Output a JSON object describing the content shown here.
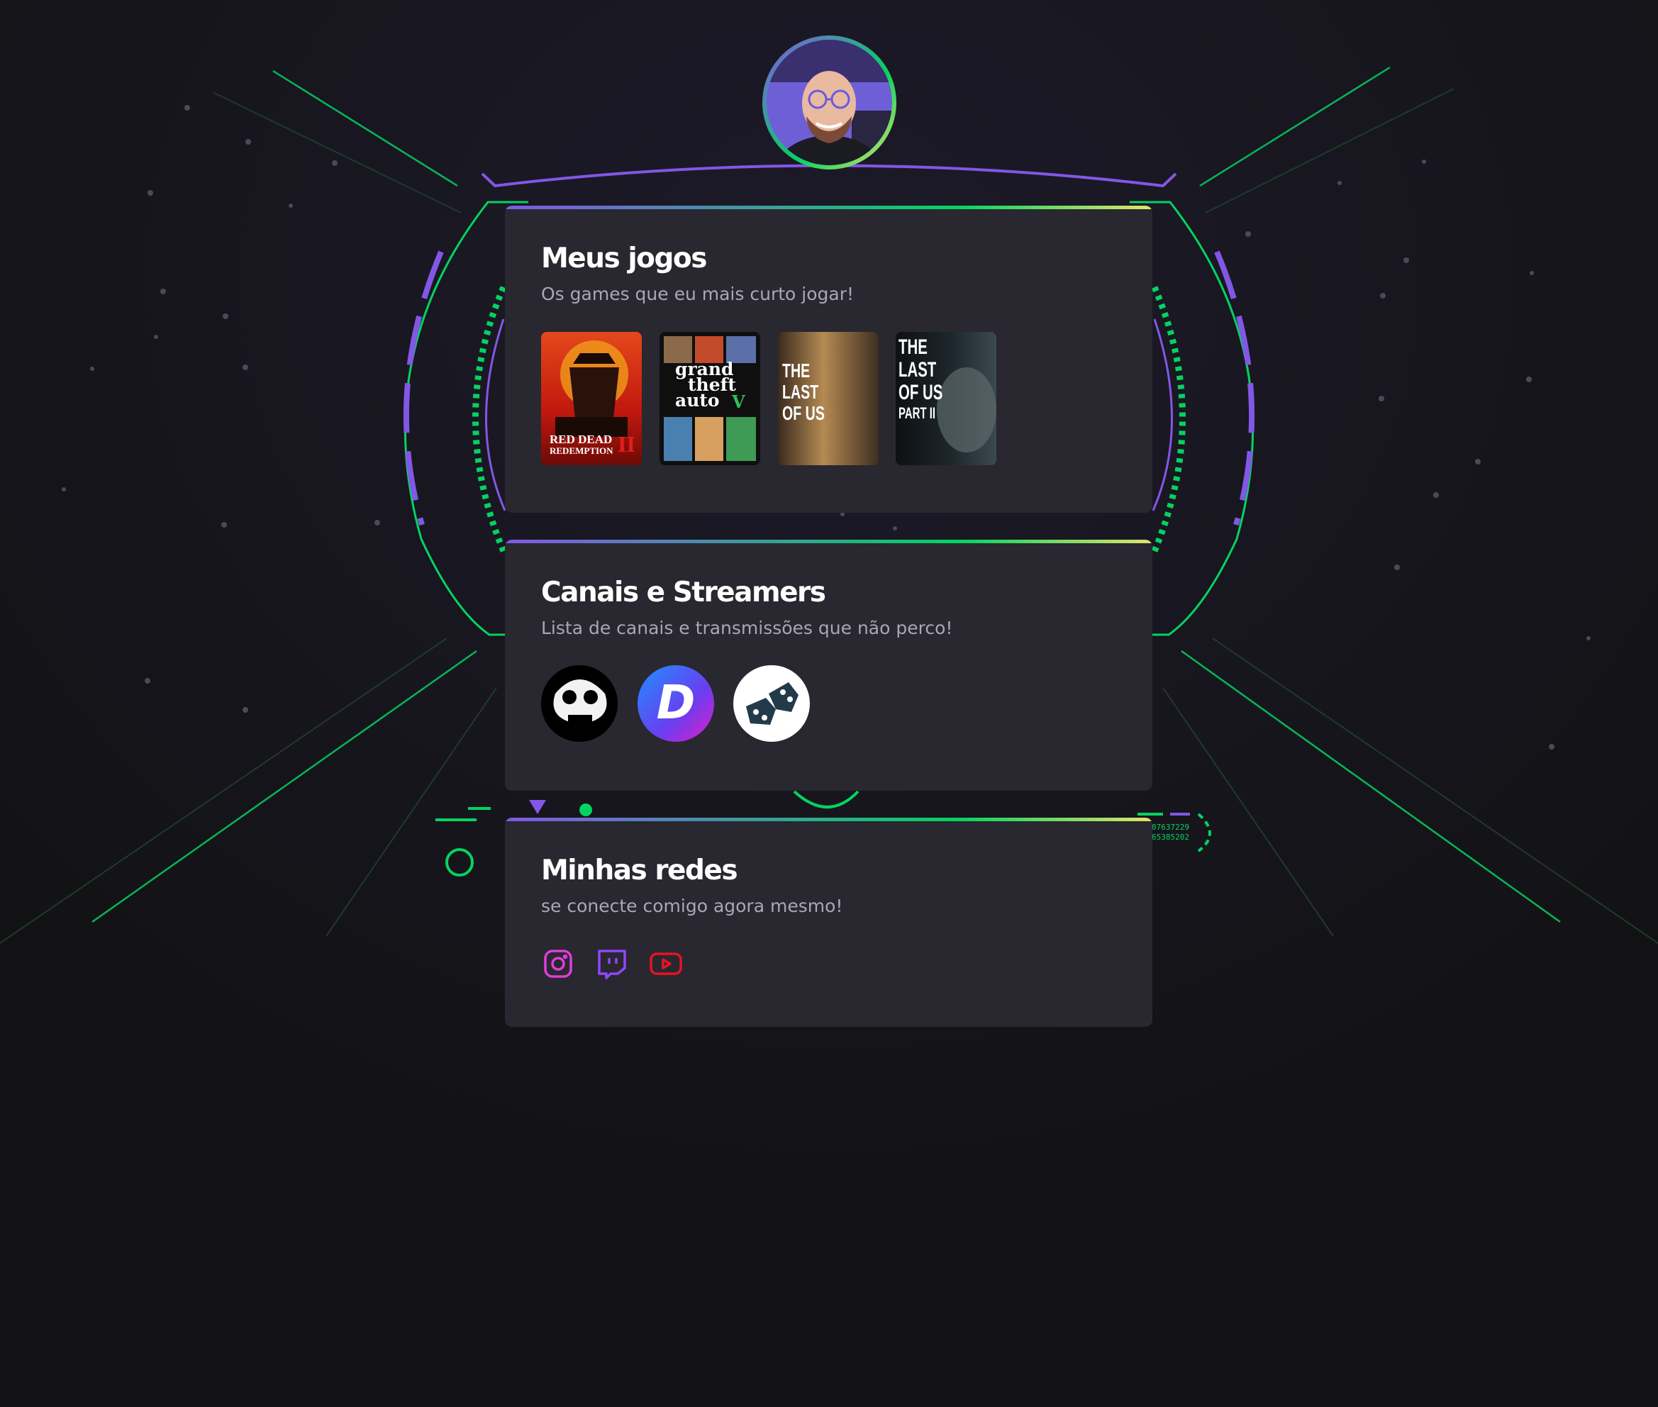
{
  "profile": {
    "avatar_alt": "avatar"
  },
  "sections": {
    "games": {
      "title": "Meus jogos",
      "subtitle": "Os games que eu mais curto jogar!",
      "items": [
        {
          "name": "Red Dead Redemption II",
          "lines": [
            "RED DEAD",
            "REDEMPTION"
          ],
          "badge": "II"
        },
        {
          "name": "Grand Theft Auto V",
          "lines": [
            "grand",
            "theft",
            "auto"
          ],
          "badge": "V"
        },
        {
          "name": "The Last of Us",
          "lines": [
            "THE",
            "LAST",
            "OF US"
          ]
        },
        {
          "name": "The Last of Us Part II",
          "lines": [
            "THE",
            "LAST",
            "OF US",
            "PART II"
          ]
        }
      ]
    },
    "channels": {
      "title": "Canais e Streamers",
      "subtitle": "Lista de canais e transmissões que não perco!",
      "items": [
        {
          "name": "channel-1"
        },
        {
          "name": "channel-2",
          "glyph": "D"
        },
        {
          "name": "channel-3"
        }
      ]
    },
    "socials": {
      "title": "Minhas redes",
      "subtitle": "se conecte comigo agora mesmo!",
      "items": [
        {
          "name": "instagram-icon",
          "color": "#e03ddd"
        },
        {
          "name": "twitch-icon",
          "color": "#9146ff"
        },
        {
          "name": "youtube-icon",
          "color": "#e81224"
        }
      ]
    }
  },
  "colors": {
    "background": "#121214",
    "card": "#29272f",
    "purple": "#8257e5",
    "green": "#04d361",
    "yellow": "#e1e46b",
    "subtitle": "#a8a8b3"
  }
}
